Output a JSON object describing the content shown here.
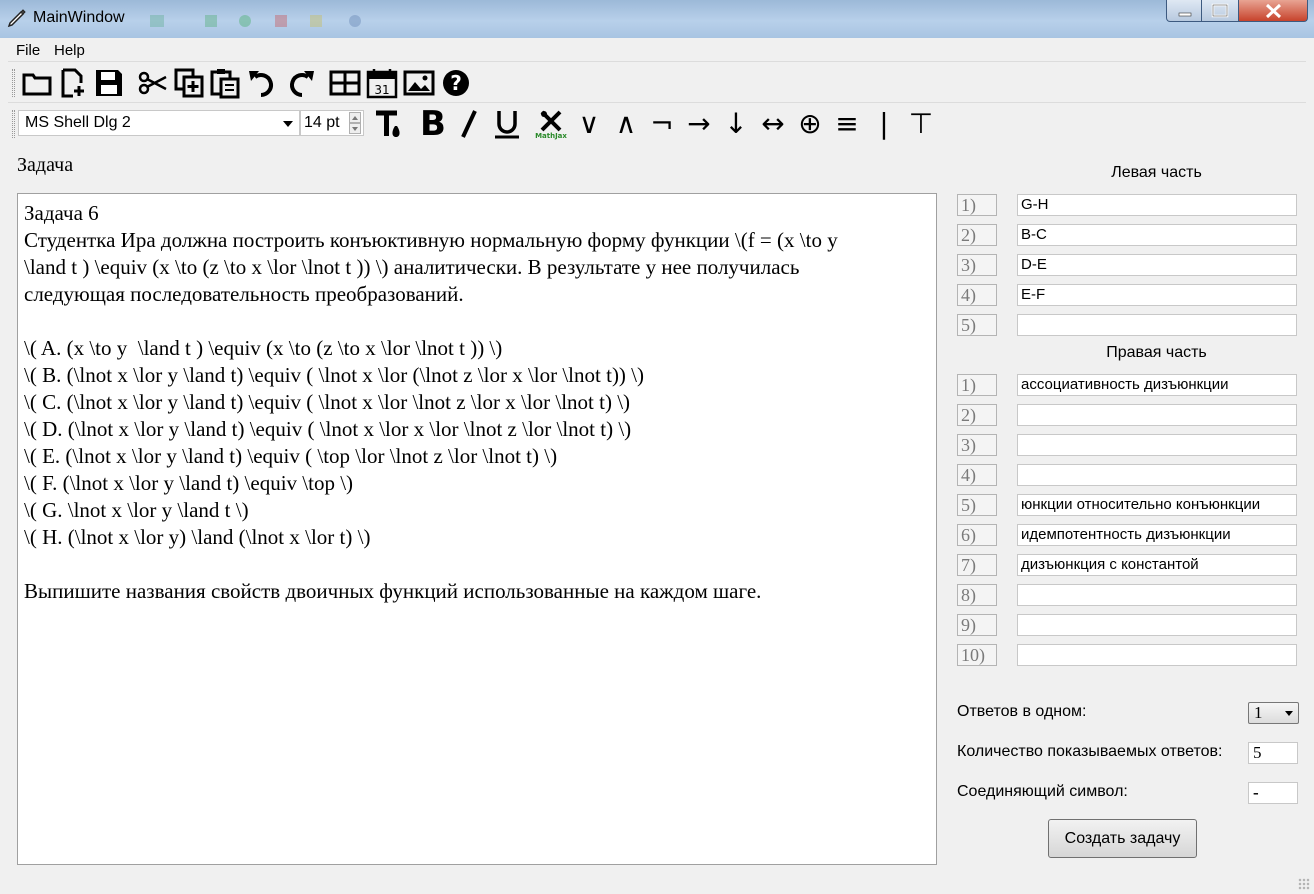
{
  "window": {
    "title": "MainWindow"
  },
  "menu": [
    "File",
    "Help"
  ],
  "toolbar_main": {
    "icons": [
      "open-folder-icon",
      "new-file-icon",
      "save-icon",
      "cut-icon",
      "copy-icon",
      "paste-icon",
      "undo-icon",
      "redo-icon",
      "table-icon",
      "calendar-icon",
      "image-icon",
      "help-icon"
    ],
    "calendar_day": "31"
  },
  "toolbar_format": {
    "font": "MS Shell Dlg 2",
    "size": "14 pt",
    "buttons": [
      {
        "name": "text-color-button",
        "glyph": "T"
      },
      {
        "name": "bold-button",
        "glyph": "B"
      },
      {
        "name": "italic-button",
        "glyph": "I"
      },
      {
        "name": "underline-button",
        "glyph": "U"
      },
      {
        "name": "mathjax-button",
        "glyph": "✖",
        "label": "MathJax"
      },
      {
        "name": "or-button",
        "glyph": "∨"
      },
      {
        "name": "and-button",
        "glyph": "∧"
      },
      {
        "name": "not-button",
        "glyph": "¬"
      },
      {
        "name": "implies-button",
        "glyph": "→"
      },
      {
        "name": "nor-button",
        "glyph": "↓"
      },
      {
        "name": "equiv-button",
        "glyph": "↔"
      },
      {
        "name": "xor-button",
        "glyph": "⊕"
      },
      {
        "name": "identical-button",
        "glyph": "≡"
      },
      {
        "name": "sheffer-button",
        "glyph": "|"
      },
      {
        "name": "top-button",
        "glyph": "⊤"
      }
    ]
  },
  "task": {
    "label": "Задача",
    "lines": [
      "Задача 6",
      "Студентка Ира должна построить конъюктивную нормальную форму функции \\(f = (x \\to y",
      "\\land t ) \\equiv (x \\to (z \\to x \\lor \\lnot t )) \\) аналитически. В результате у нее получилась",
      "следующая последовательность преобразований.",
      "",
      "\\( A. (x \\to y  \\land t ) \\equiv (x \\to (z \\to x \\lor \\lnot t )) \\)",
      "\\( B. (\\lnot x \\lor y \\land t) \\equiv ( \\lnot x \\lor (\\lnot z \\lor x \\lor \\lnot t)) \\)",
      "\\( C. (\\lnot x \\lor y \\land t) \\equiv ( \\lnot x \\lor \\lnot z \\lor x \\lor \\lnot t) \\)",
      "\\( D. (\\lnot x \\lor y \\land t) \\equiv ( \\lnot x \\lor x \\lor \\lnot z \\lor \\lnot t) \\)",
      "\\( E. (\\lnot x \\lor y \\land t) \\equiv ( \\top \\lor \\lnot z \\lor \\lnot t) \\)",
      "\\( F. (\\lnot x \\lor y \\land t) \\equiv \\top \\)",
      "\\( G. \\lnot x \\lor y \\land t \\)",
      "\\( H. (\\lnot x \\lor y) \\land (\\lnot x \\lor t) \\)",
      "",
      "Выпишите названия свойств двоичных функций использованные на каждом шаге."
    ]
  },
  "left_part": {
    "heading": "Левая часть",
    "rows": [
      {
        "num": "1)",
        "value": "G-H"
      },
      {
        "num": "2)",
        "value": "B-C"
      },
      {
        "num": "3)",
        "value": "D-E"
      },
      {
        "num": "4)",
        "value": "E-F"
      },
      {
        "num": "5)",
        "value": ""
      }
    ]
  },
  "right_part": {
    "heading": "Правая часть",
    "rows": [
      {
        "num": "1)",
        "value": "ассоциативность дизъюнкции"
      },
      {
        "num": "2)",
        "value": ""
      },
      {
        "num": "3)",
        "value": ""
      },
      {
        "num": "4)",
        "value": ""
      },
      {
        "num": "5)",
        "value": "юнкции относительно конъюнкции"
      },
      {
        "num": "6)",
        "value": "идемпотентность дизъюнкции"
      },
      {
        "num": "7)",
        "value": "дизъюнкция с константой"
      },
      {
        "num": "8)",
        "value": ""
      },
      {
        "num": "9)",
        "value": ""
      },
      {
        "num": "10)",
        "value": ""
      }
    ]
  },
  "options": {
    "answers_per_label": "Ответов в одном:",
    "answers_per_value": "1",
    "shown_count_label": "Количество показываемых ответов:",
    "shown_count_value": "5",
    "join_symbol_label": "Соединяющий символ:",
    "join_symbol_value": "-"
  },
  "create_button": "Создать задачу"
}
